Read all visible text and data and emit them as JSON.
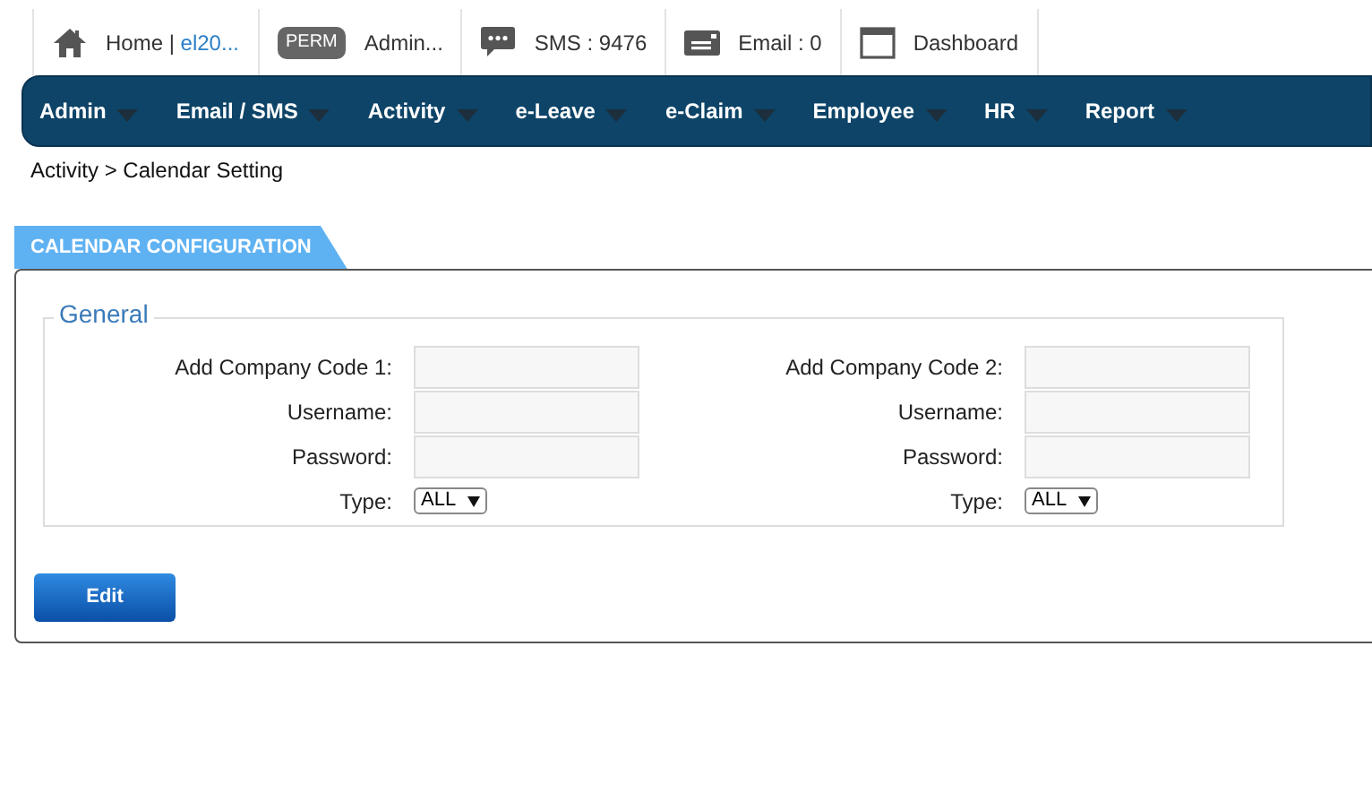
{
  "topbar": [
    {
      "kind": "home",
      "label": "Home | ",
      "link": "el20..."
    },
    {
      "kind": "perm",
      "badge": "PERM",
      "label": "Admin..."
    },
    {
      "kind": "sms",
      "label": "SMS : 9476"
    },
    {
      "kind": "email",
      "label": "Email : 0"
    },
    {
      "kind": "dashboard",
      "label": "Dashboard"
    }
  ],
  "menu": [
    "Admin",
    "Email / SMS",
    "Activity",
    "e-Leave",
    "e-Claim",
    "Employee",
    "HR",
    "Report"
  ],
  "breadcrumb": "Activity > Calendar Setting",
  "panel_tab": "CALENDAR CONFIGURATION",
  "fieldset": {
    "legend": "General",
    "columns": [
      {
        "fields": [
          {
            "kind": "text",
            "label": "Add Company Code 1:"
          },
          {
            "kind": "text",
            "label": "Username:"
          },
          {
            "kind": "text",
            "label": "Password:"
          },
          {
            "kind": "select",
            "label": "Type:",
            "value": "ALL"
          }
        ]
      },
      {
        "fields": [
          {
            "kind": "text",
            "label": "Add Company Code 2:"
          },
          {
            "kind": "text",
            "label": "Username:"
          },
          {
            "kind": "text",
            "label": "Password:"
          },
          {
            "kind": "select",
            "label": "Type:",
            "value": "ALL"
          }
        ]
      }
    ]
  },
  "edit_button": "Edit"
}
